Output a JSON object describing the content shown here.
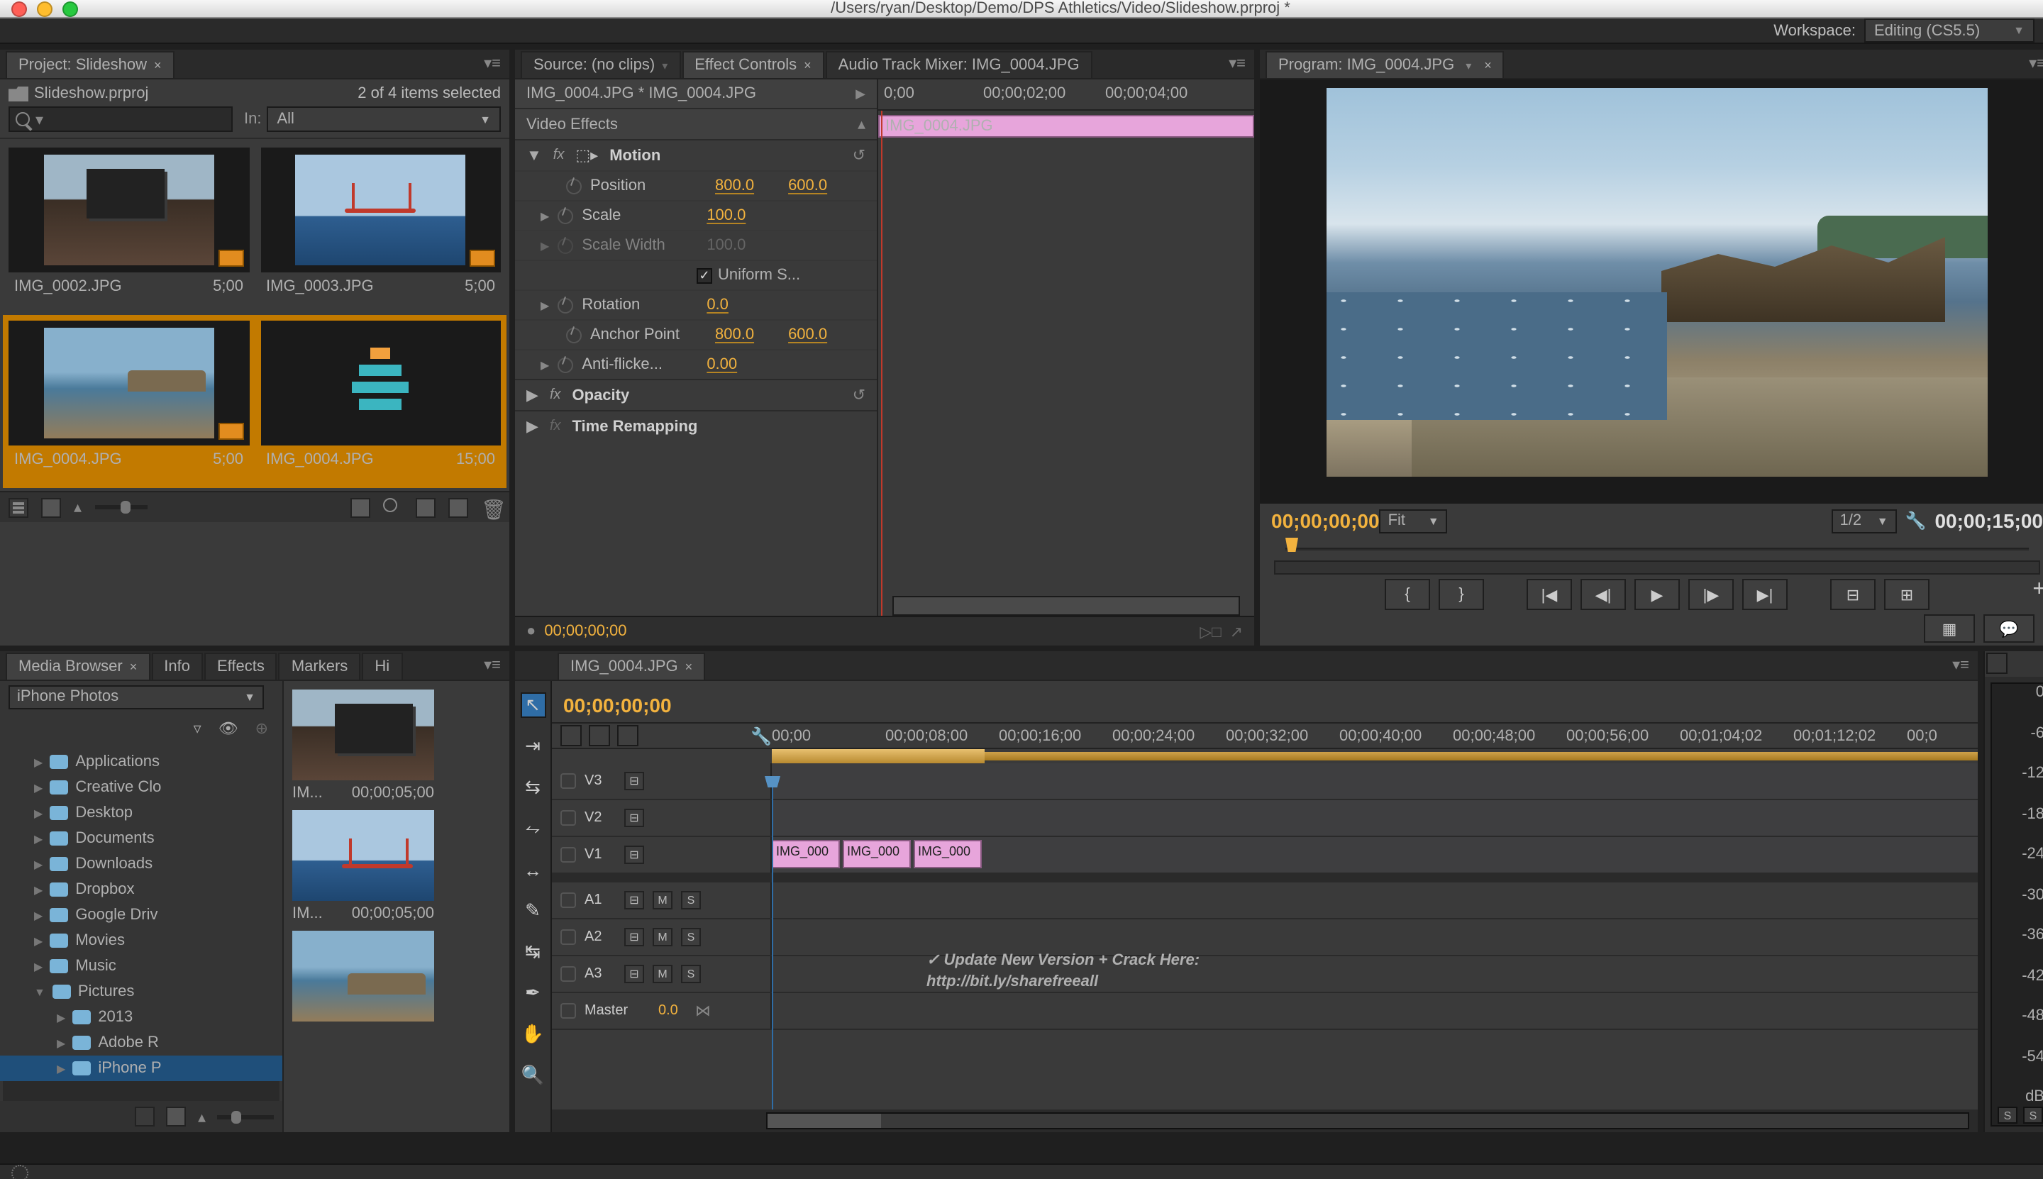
{
  "titlebar": {
    "title": "/Users/ryan/Desktop/Demo/DPS Athletics/Video/Slideshow.prproj *"
  },
  "workspace": {
    "label": "Workspace:",
    "value": "Editing (CS5.5)"
  },
  "project": {
    "tab": "Project: Slideshow",
    "filename": "Slideshow.prproj",
    "selection": "2 of 4 items selected",
    "in_label": "In:",
    "in_value": "All",
    "items": [
      {
        "name": "IMG_0002.JPG",
        "dur": "5;00",
        "kind": "imgA",
        "hd": true,
        "sel": false
      },
      {
        "name": "IMG_0003.JPG",
        "dur": "5;00",
        "kind": "imgB",
        "hd": true,
        "sel": false
      },
      {
        "name": "IMG_0004.JPG",
        "dur": "5;00",
        "kind": "imgC",
        "hd": true,
        "sel": true
      },
      {
        "name": "IMG_0004.JPG",
        "dur": "15;00",
        "kind": "seq",
        "hd": false,
        "sel": true
      }
    ]
  },
  "source_tabs": {
    "source": "Source: (no clips)",
    "effect": "Effect Controls",
    "mixer": "Audio Track Mixer: IMG_0004.JPG"
  },
  "effect_controls": {
    "header": "IMG_0004.JPG * IMG_0004.JPG",
    "section": "Video Effects",
    "clip_name": "IMG_0004.JPG",
    "motion": {
      "label": "Motion",
      "position": {
        "label": "Position",
        "x": "800.0",
        "y": "600.0"
      },
      "scale": {
        "label": "Scale",
        "v": "100.0"
      },
      "scale_width": {
        "label": "Scale Width",
        "v": "100.0"
      },
      "uniform": {
        "label": "Uniform S...",
        "checked": true
      },
      "rotation": {
        "label": "Rotation",
        "v": "0.0"
      },
      "anchor": {
        "label": "Anchor Point",
        "x": "800.0",
        "y": "600.0"
      },
      "antiflicker": {
        "label": "Anti-flicke...",
        "v": "0.00"
      }
    },
    "opacity": {
      "label": "Opacity"
    },
    "time_remap": {
      "label": "Time Remapping"
    },
    "ruler": [
      "0;00",
      "00;00;02;00",
      "00;00;04;00"
    ],
    "timecode": "00;00;00;00"
  },
  "program": {
    "tab": "Program: IMG_0004.JPG",
    "timecode_l": "00;00;00;00",
    "timecode_r": "00;00;15;00",
    "fit": "Fit",
    "res": "1/2"
  },
  "media_browser": {
    "tabs": [
      "Media Browser",
      "Info",
      "Effects",
      "Markers",
      "Hi"
    ],
    "source": "iPhone Photos",
    "tree": [
      "Applications",
      "Creative Clo",
      "Desktop",
      "Documents",
      "Downloads",
      "Dropbox",
      "Google Driv",
      "Movies",
      "Music",
      "Pictures"
    ],
    "subtree": [
      "2013",
      "Adobe R",
      "iPhone P"
    ],
    "thumbs": [
      {
        "name": "IM...",
        "dur": "00;00;05;00",
        "kind": "imgA"
      },
      {
        "name": "IM...",
        "dur": "00;00;05;00",
        "kind": "imgB"
      },
      {
        "name": "",
        "dur": "",
        "kind": "imgC"
      }
    ]
  },
  "timeline": {
    "tab": "IMG_0004.JPG",
    "timecode": "00;00;00;00",
    "ruler": [
      "00;00",
      "00;00;08;00",
      "00;00;16;00",
      "00;00;24;00",
      "00;00;32;00",
      "00;00;40;00",
      "00;00;48;00",
      "00;00;56;00",
      "00;01;04;02",
      "00;01;12;02",
      "00;0"
    ],
    "vtracks": [
      "V3",
      "V2",
      "V1"
    ],
    "atracks": [
      "A1",
      "A2",
      "A3"
    ],
    "master_label": "Master",
    "master_val": "0.0",
    "clips": [
      "IMG_000",
      "IMG_000",
      "IMG_000"
    ]
  },
  "meter": {
    "scale": [
      "0",
      "-6",
      "-12",
      "-18",
      "-24",
      "-30",
      "-36",
      "-42",
      "-48",
      "-54",
      "dB"
    ]
  },
  "overlay": {
    "line1": "✓ Update New Version + Crack Here:",
    "line2": "http://bit.ly/sharefreeall"
  }
}
